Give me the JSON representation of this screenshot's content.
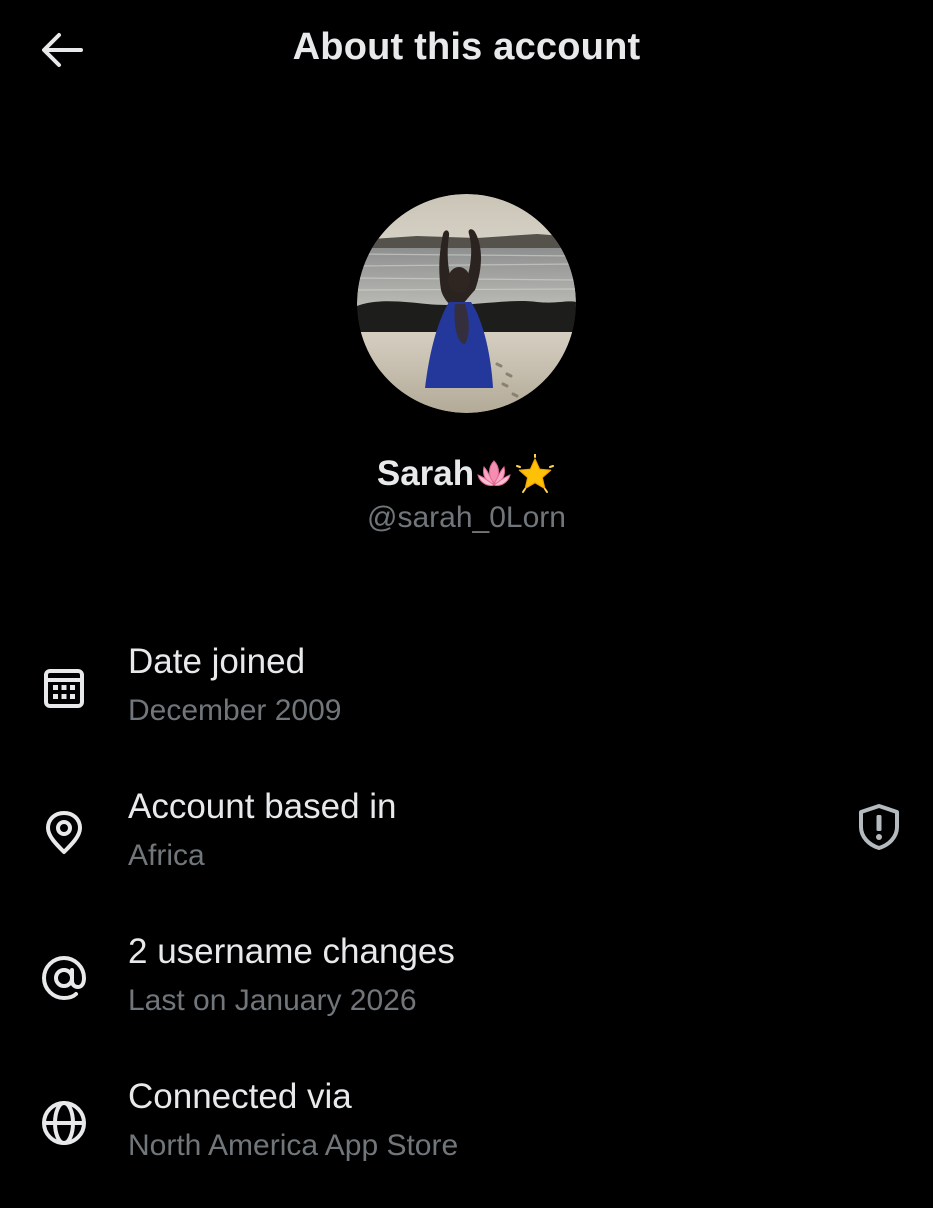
{
  "header": {
    "title": "About this account",
    "back_icon": "arrow-left-icon"
  },
  "profile": {
    "display_name": "Sarah",
    "name_emojis": [
      "lotus-emoji",
      "glowing-star-emoji"
    ],
    "handle": "@sarah_0Lorn"
  },
  "info": {
    "date_joined": {
      "label": "Date joined",
      "value": "December 2009",
      "icon": "calendar-icon"
    },
    "based_in": {
      "label": "Account based in",
      "value": "Africa",
      "icon": "location-pin-icon",
      "action_icon": "shield-alert-icon"
    },
    "username_changes": {
      "label": "2 username changes",
      "value": "Last on January 2026",
      "icon": "at-sign-icon"
    },
    "connected_via": {
      "label": "Connected via",
      "value": "North America App Store",
      "icon": "globe-icon"
    }
  },
  "colors": {
    "background": "#000000",
    "primary_text": "#e7e9ea",
    "secondary_text": "#71767b",
    "lotus_pink": "#f48fb1",
    "star_yellow": "#ffc107"
  }
}
